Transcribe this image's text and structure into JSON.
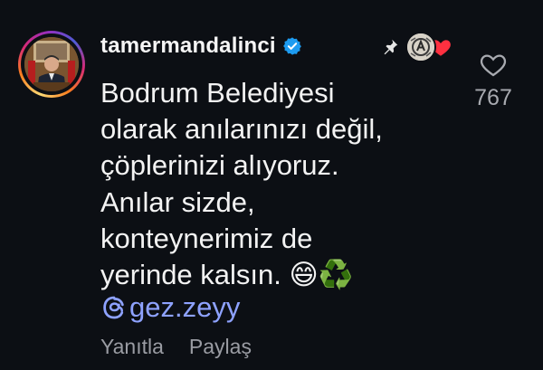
{
  "comment": {
    "username": "tamermandalinci",
    "text_lines": [
      "Bodrum Belediyesi",
      "olarak anılarınızı değil,",
      "çöplerinizi alıyoruz.",
      "Anılar sizde,",
      "konteynerimiz de",
      "yerinde kalsın. 😄♻️"
    ],
    "mention": "gez.zeyy",
    "like_count": "767"
  },
  "actions": {
    "reply_label": "Yanıtla",
    "share_label": "Paylaş"
  },
  "icons": {
    "verified": "verified-badge-icon",
    "pin": "pin-icon",
    "heart_badge": "heart-icon",
    "threads": "threads-icon",
    "like": "heart-outline-icon"
  },
  "colors": {
    "background": "#0c0f14",
    "mention": "#8ea2ff",
    "verified": "#1d9bf0",
    "heart": "#ff3040",
    "muted": "#9a9ca3"
  }
}
